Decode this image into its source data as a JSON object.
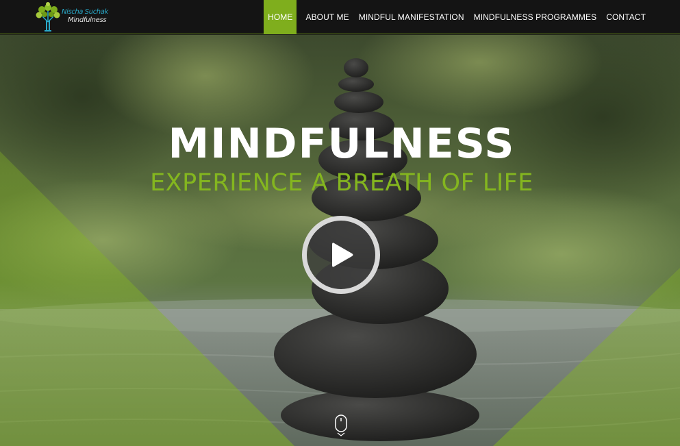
{
  "brand": {
    "name_line1": "Nischa Suchak",
    "name_line2": "Mindfulness",
    "accent_color": "#7fae1d"
  },
  "nav": {
    "items": [
      {
        "label": "HOME",
        "active": true
      },
      {
        "label": "ABOUT ME",
        "active": false
      },
      {
        "label": "MINDFUL MANIFESTATION",
        "active": false
      },
      {
        "label": "MINDFULNESS PROGRAMMES",
        "active": false
      },
      {
        "label": "CONTACT",
        "active": false
      }
    ]
  },
  "hero": {
    "title": "MINDFULNESS",
    "subtitle": "EXPERIENCE A BREATH OF LIFE",
    "title_color": "#ffffff",
    "subtitle_color": "#84b61f",
    "play_icon": "play-icon",
    "scroll_icon": "mouse-scroll-icon"
  }
}
